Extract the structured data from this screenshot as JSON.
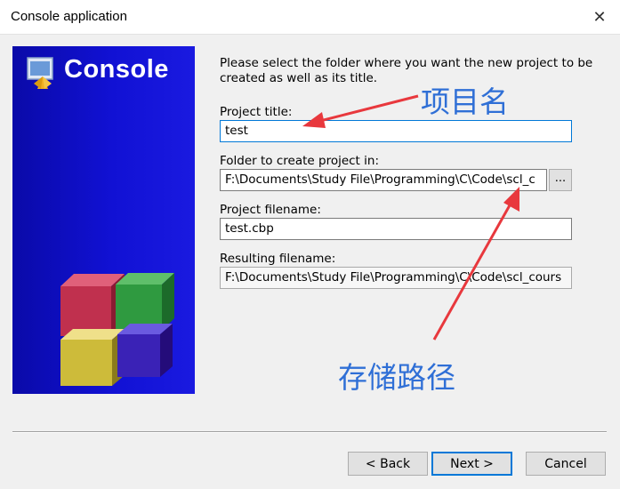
{
  "window": {
    "title": "Console application",
    "close_glyph": "✕"
  },
  "banner": {
    "title": "Console",
    "icon": "app-console-icon"
  },
  "instructions": "Please select the folder where you want the new project to be created as well as its title.",
  "fields": {
    "project_title": {
      "label": "Project title:",
      "value": "test"
    },
    "folder": {
      "label": "Folder to create project in:",
      "value": "F:\\Documents\\Study File\\Programming\\C\\Code\\scl_c",
      "browse_label": "..."
    },
    "project_filename": {
      "label": "Project filename:",
      "value": "test.cbp"
    },
    "resulting_filename": {
      "label": "Resulting filename:",
      "value": "F:\\Documents\\Study File\\Programming\\C\\Code\\scl_cours"
    }
  },
  "buttons": {
    "back": "< Back",
    "next": "Next >",
    "cancel": "Cancel"
  },
  "annotations": {
    "title_note": "项目名",
    "path_note": "存储路径",
    "arrow_color": "#e8383d",
    "text_color": "#2f6fd6"
  },
  "colors": {
    "banner_blue": "#1111d4",
    "focus_border": "#0078d7"
  }
}
